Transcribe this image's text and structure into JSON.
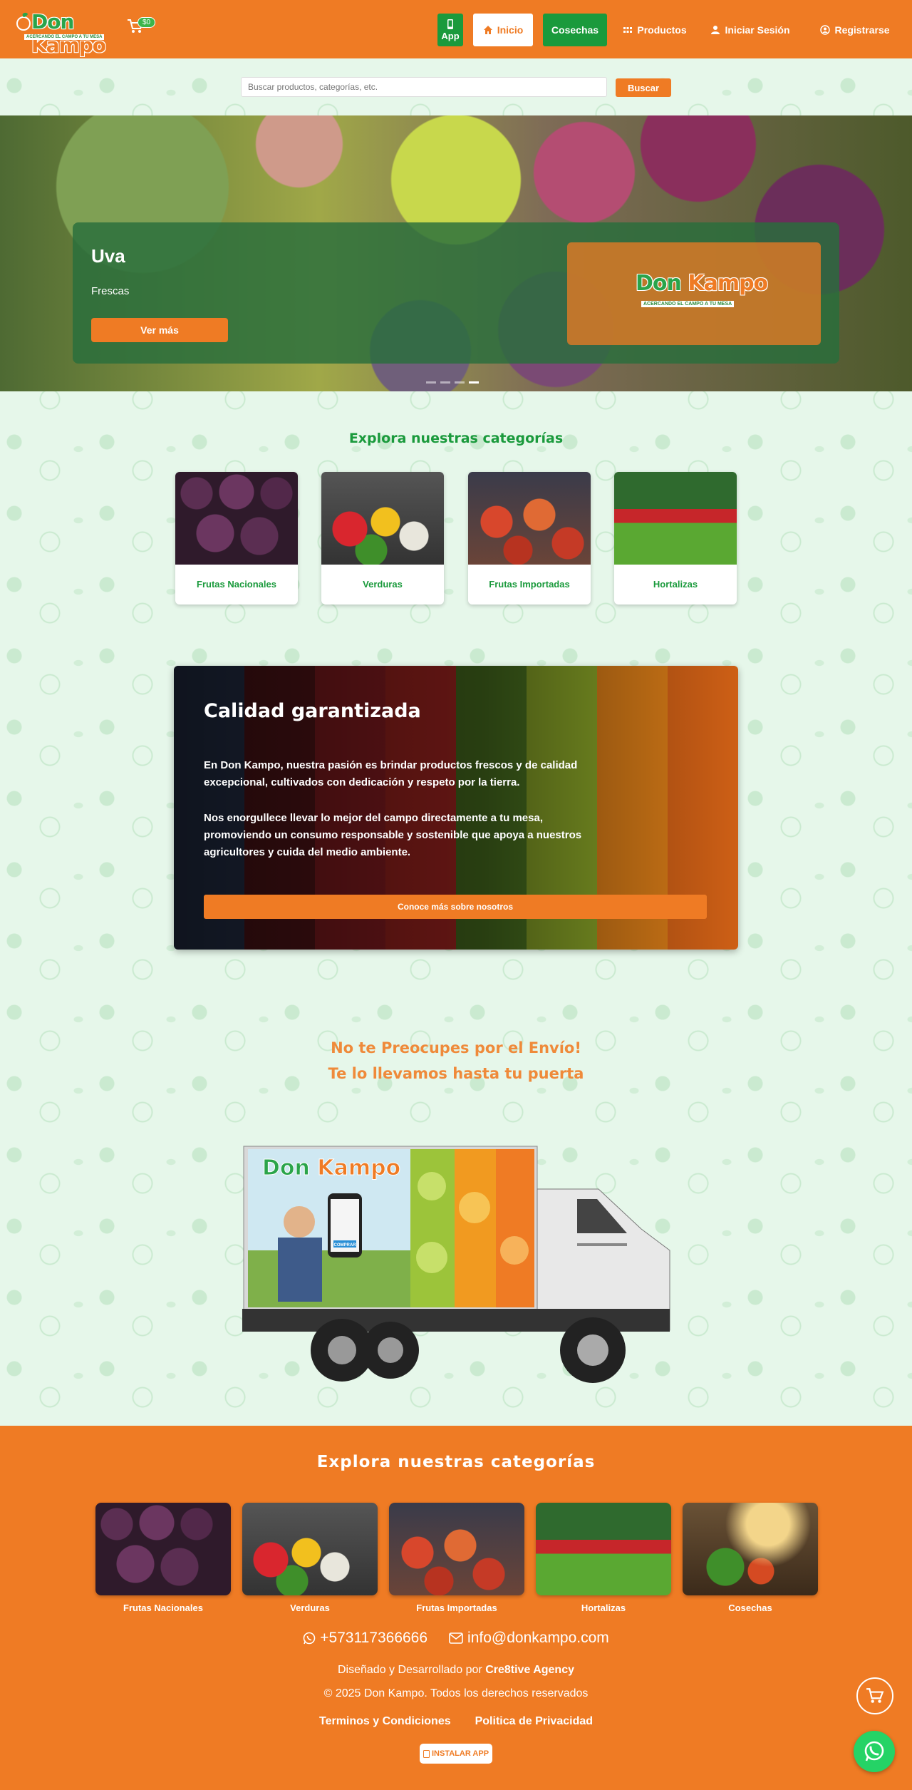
{
  "brand": {
    "name_part1": "Don ",
    "name_part2": "Kampo",
    "tagline": "ACERCANDO EL CAMPO A TU MESA",
    "cart_badge": "$0",
    "primary_color": "#ef7b24",
    "secondary_color": "#1a9a3c"
  },
  "nav": {
    "app_label": "App",
    "inicio_label": "Inicio",
    "cosechas_label": "Cosechas",
    "productos_label": "Productos",
    "login_label": "Iniciar Sesión",
    "register_label": "Registrarse"
  },
  "search": {
    "placeholder": "Buscar productos, categorías, etc.",
    "button_label": "Buscar"
  },
  "hero": {
    "title": "Uva",
    "subtitle": "Frescas",
    "button_label": "Ver más",
    "slides_count": 4,
    "active_slide": 4
  },
  "categories": {
    "title": "Explora nuestras categorías",
    "items": [
      {
        "label": "Frutas Nacionales"
      },
      {
        "label": "Verduras"
      },
      {
        "label": "Frutas Importadas"
      },
      {
        "label": "Hortalizas"
      }
    ]
  },
  "quality": {
    "title": "Calidad garantizada",
    "paragraph1": "En Don Kampo, nuestra pasión es brindar productos frescos y de calidad excepcional, cultivados con dedicación y respeto por la tierra.",
    "paragraph2": "Nos enorgullece llevar lo mejor del campo directamente a tu mesa, promoviendo un consumo responsable y sostenible que apoya a nuestros agricultores y cuida del medio ambiente.",
    "button_label": "Conoce más sobre nosotros"
  },
  "shipping": {
    "line1": "No te Preocupes por el Envío!",
    "line2": "Te lo llevamos hasta tu puerta",
    "truck_button": "COMPRAR"
  },
  "footer": {
    "title": "Explora nuestras categorías",
    "categories": [
      {
        "label": "Frutas Nacionales"
      },
      {
        "label": "Verduras"
      },
      {
        "label": "Frutas Importadas"
      },
      {
        "label": "Hortalizas"
      },
      {
        "label": "Cosechas"
      }
    ],
    "phone": "+573117366666",
    "email": "info@donkampo.com",
    "designed_prefix": "Diseñado y Desarrollado por ",
    "designed_by": "Cre8tive Agency",
    "copyright": "© 2025 Don Kampo. Todos los derechos reservados",
    "terms_label": "Terminos y Condiciones",
    "privacy_label": "Politica de Privacidad",
    "install_label": "INSTALAR APP"
  }
}
